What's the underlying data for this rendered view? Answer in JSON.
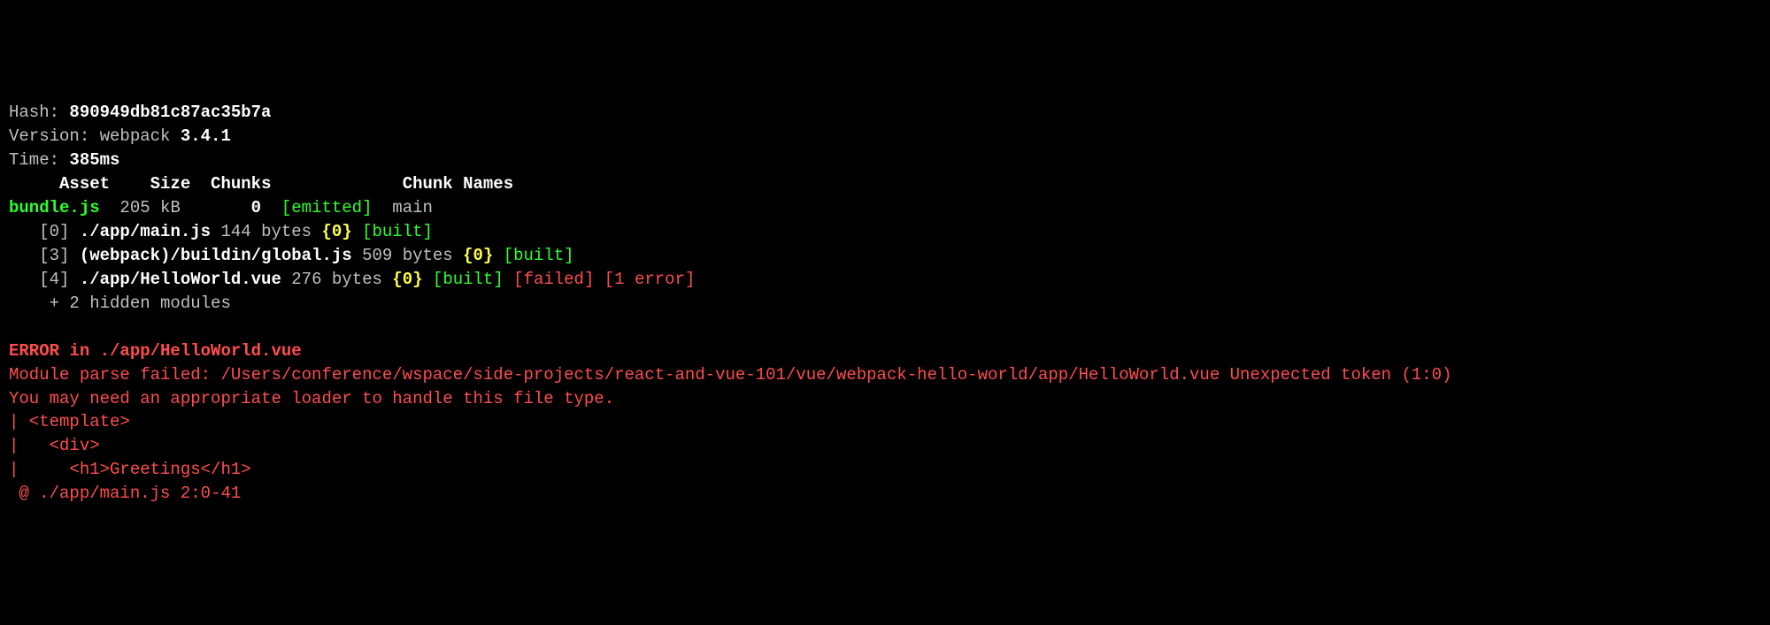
{
  "header": {
    "hash_label": "Hash: ",
    "hash_value": "890949db81c87ac35b7a",
    "version_label": "Version: webpack ",
    "version_value": "3.4.1",
    "time_label": "Time: ",
    "time_value": "385ms"
  },
  "table_header": {
    "asset": "     Asset",
    "size": "    Size",
    "chunks": "  Chunks",
    "chunk_names": "             Chunk Names"
  },
  "asset_row": {
    "name": "bundle.js",
    "size": "  205 kB",
    "chunk_id": "       0",
    "emitted": "  [emitted]",
    "chunk_name": "  main"
  },
  "modules": [
    {
      "index": "   [0] ",
      "path": "./app/main.js",
      "size": " 144 bytes ",
      "chunk_ref": "{0}",
      "status_built": " [built]",
      "status_failed": "",
      "status_errors": ""
    },
    {
      "index": "   [3] ",
      "path": "(webpack)/buildin/global.js",
      "size": " 509 bytes ",
      "chunk_ref": "{0}",
      "status_built": " [built]",
      "status_failed": "",
      "status_errors": ""
    },
    {
      "index": "   [4] ",
      "path": "./app/HelloWorld.vue",
      "size": " 276 bytes ",
      "chunk_ref": "{0}",
      "status_built": " [built]",
      "status_failed": " [failed]",
      "status_errors": " [1 error]"
    }
  ],
  "hidden": "    + 2 hidden modules",
  "error": {
    "header": "ERROR in ./app/HelloWorld.vue",
    "line1": "Module parse failed: /Users/conference/wspace/side-projects/react-and-vue-101/vue/webpack-hello-world/app/HelloWorld.vue Unexpected token (1:0)",
    "line2": "You may need an appropriate loader to handle this file type.",
    "code1": "| <template>",
    "code2": "|   <div>",
    "code3": "|     <h1>Greetings</h1>",
    "at": " @ ./app/main.js 2:0-41"
  }
}
